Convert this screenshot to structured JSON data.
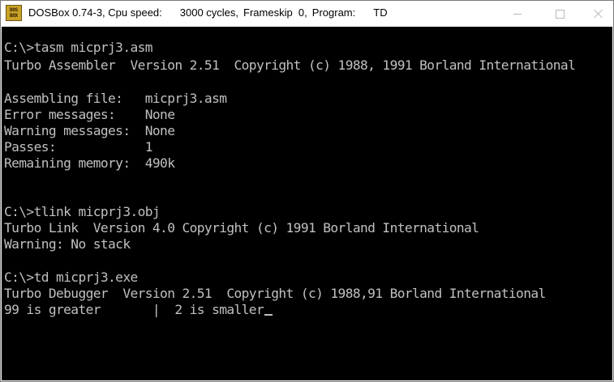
{
  "window": {
    "icon_text_line1": "DOS",
    "icon_text_line2": "BOX",
    "title_app": "DOSBox 0.74-3, Cpu speed:",
    "title_cycles": "3000 cycles,",
    "title_frameskip": "Frameskip  0,",
    "title_program_label": "Program:",
    "title_program": "TD",
    "colors": {
      "titlebar_bg": "#ffffff",
      "terminal_bg": "#000000",
      "terminal_fg": "#c0c0c0",
      "icon_bg": "#c9a227"
    },
    "controls": {
      "minimize_icon": "minimize-icon",
      "maximize_icon": "maximize-icon",
      "close_icon": "close-icon"
    }
  },
  "terminal": {
    "lines": [
      "",
      "C:\\>tasm micprj3.asm",
      "Turbo Assembler  Version 2.51  Copyright (c) 1988, 1991 Borland International",
      "",
      "Assembling file:   micprj3.asm",
      "Error messages:    None",
      "Warning messages:  None",
      "Passes:            1",
      "Remaining memory:  490k",
      "",
      "",
      "C:\\>tlink micprj3.obj",
      "Turbo Link  Version 4.0 Copyright (c) 1991 Borland International",
      "Warning: No stack",
      "",
      "C:\\>td micprj3.exe",
      "Turbo Debugger  Version 2.51  Copyright (c) 1988,91 Borland International",
      "99 is greater       |  2 is smaller"
    ]
  }
}
